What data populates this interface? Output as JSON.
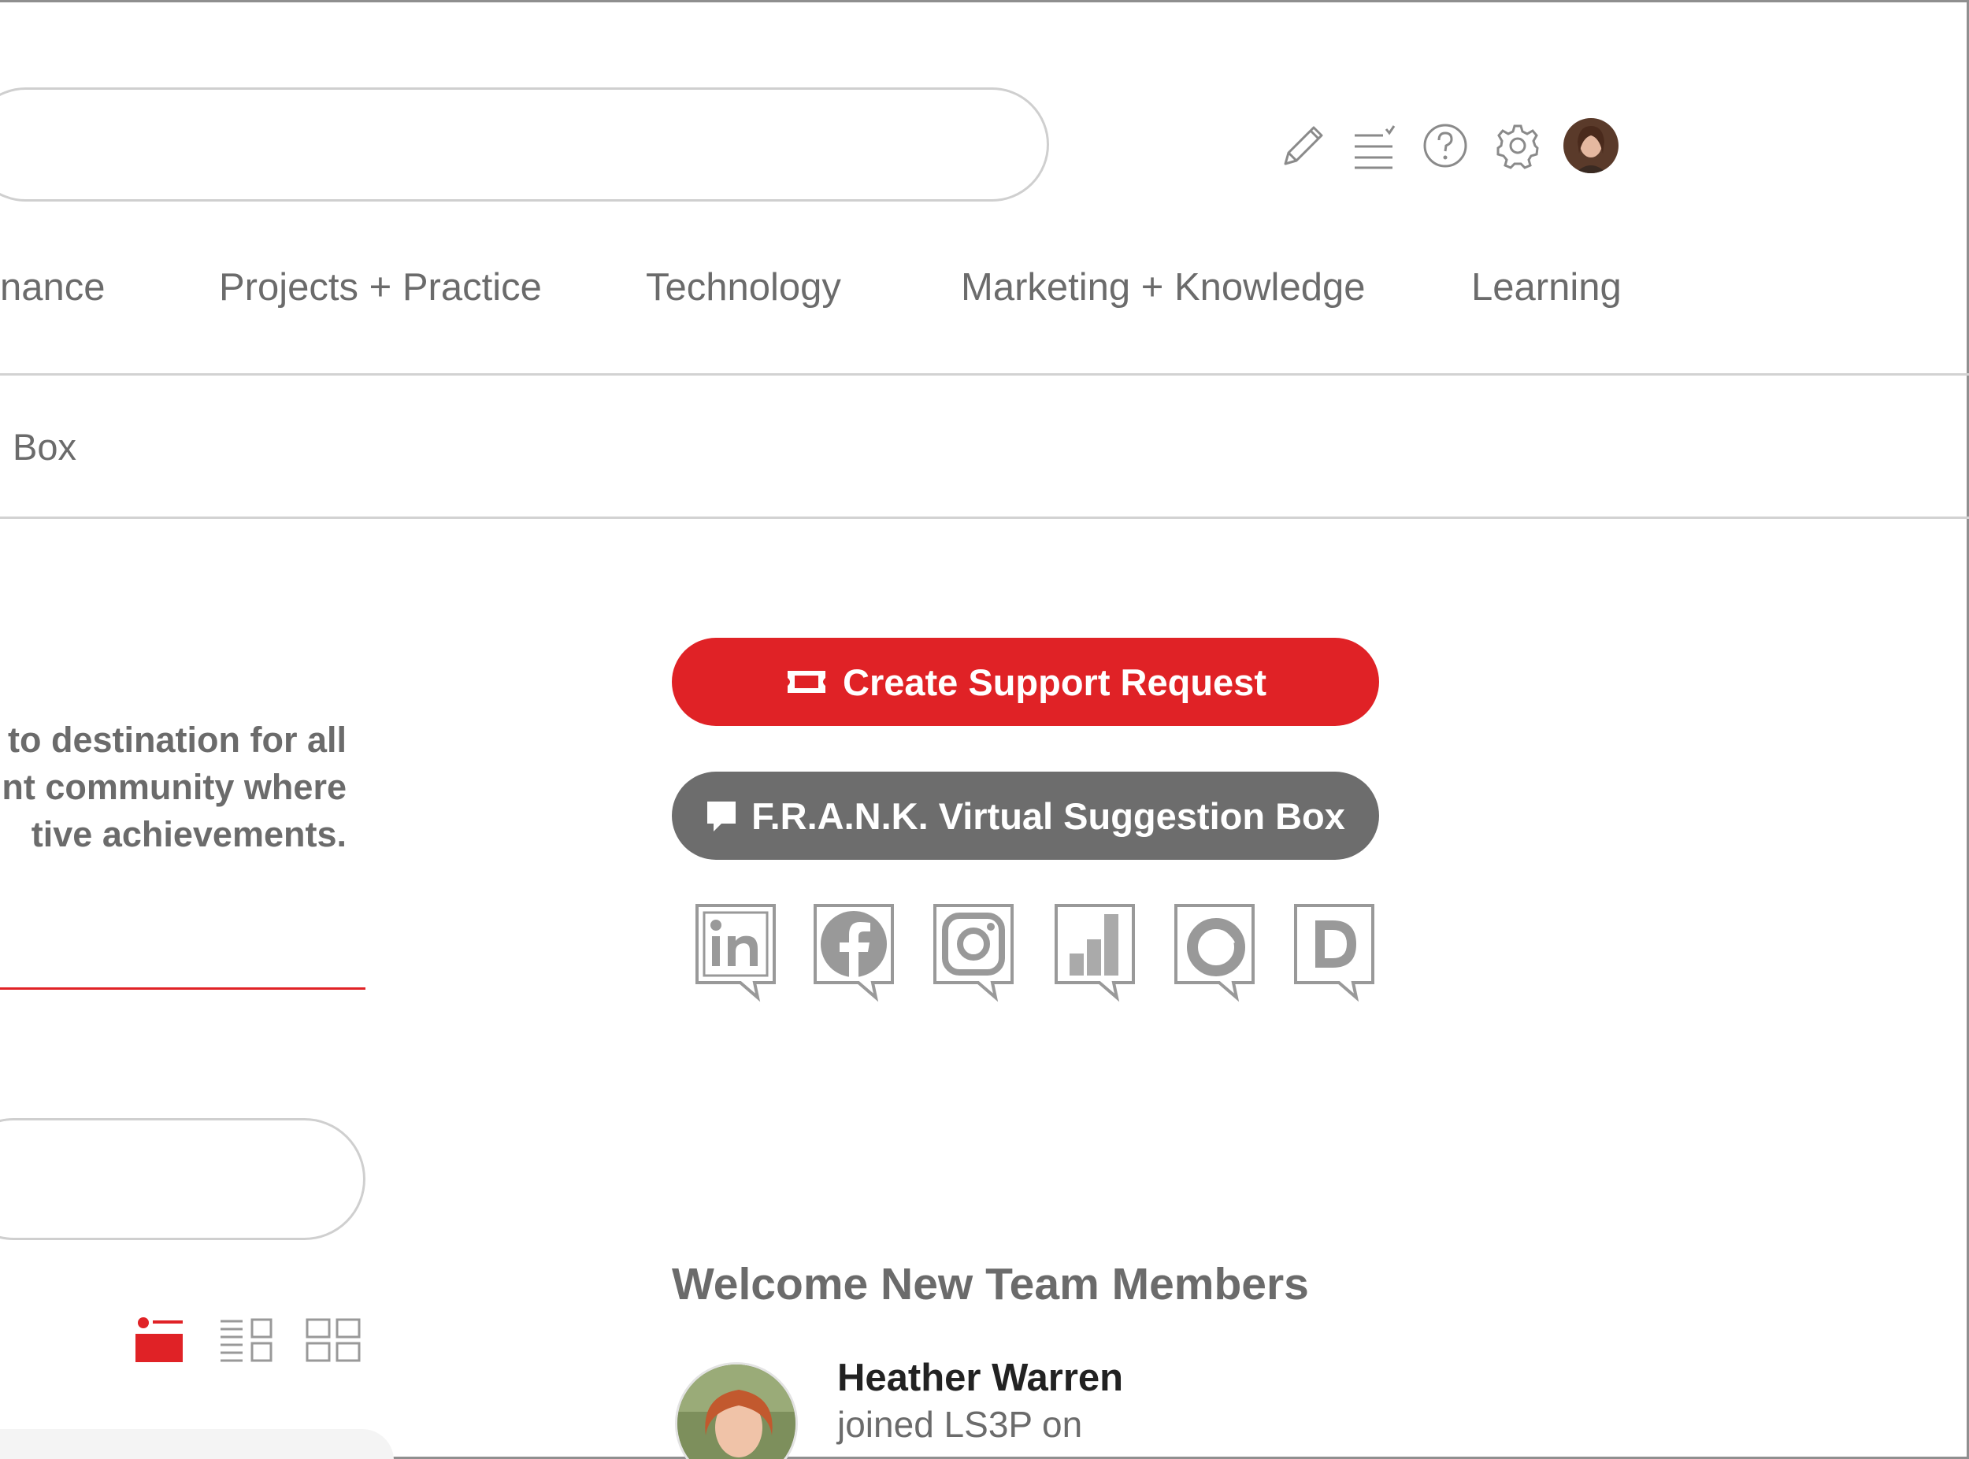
{
  "nav": {
    "items": [
      {
        "label": "nance"
      },
      {
        "label": "Projects + Practice"
      },
      {
        "label": "Technology"
      },
      {
        "label": "Marketing + Knowledge"
      },
      {
        "label": "Learning"
      }
    ]
  },
  "breadcrumb": {
    "label": "Box"
  },
  "header": {
    "icons": [
      "pencil-icon",
      "task-list-icon",
      "help-icon",
      "gear-icon",
      "user-avatar"
    ]
  },
  "intro": {
    "lines": [
      "to destination for all",
      "nt community where",
      "tive achievements."
    ]
  },
  "actions": {
    "support_label": "Create Support Request",
    "suggestion_label": "F.R.A.N.K. Virtual Suggestion Box"
  },
  "social": [
    "linkedin-icon",
    "facebook-icon",
    "instagram-icon",
    "stats-icon",
    "circle-logo-icon",
    "d-logo-icon"
  ],
  "view_modes": [
    "list-view-icon",
    "compact-list-view-icon",
    "grid-view-icon"
  ],
  "welcome": {
    "title": "Welcome New Team Members",
    "members": [
      {
        "name": "Heather Warren",
        "subtitle": "joined LS3P on"
      }
    ]
  },
  "colors": {
    "accent": "#e02226",
    "secondary": "#6d6d6d",
    "text": "#6b6b6b"
  }
}
